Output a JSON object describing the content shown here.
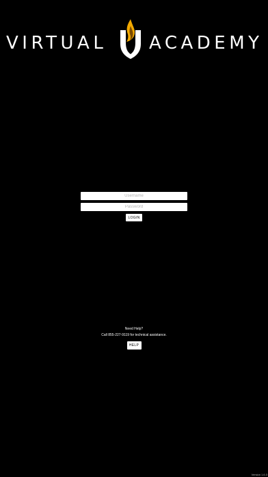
{
  "logo": {
    "left_word": "VIRTUAL",
    "right_word": "ACADEMY",
    "emblem_icon": "flame-shield-icon",
    "flame_color": "#F2A900",
    "shield_color": "#FFFFFF"
  },
  "login": {
    "username_placeholder": "Username",
    "password_placeholder": "Password",
    "login_label": "LOGIN"
  },
  "help": {
    "title": "Need Help?",
    "text": "Call 855-227-9119 for technical assistance.",
    "button_label": "HELP"
  },
  "version": "Version 1.6.3"
}
